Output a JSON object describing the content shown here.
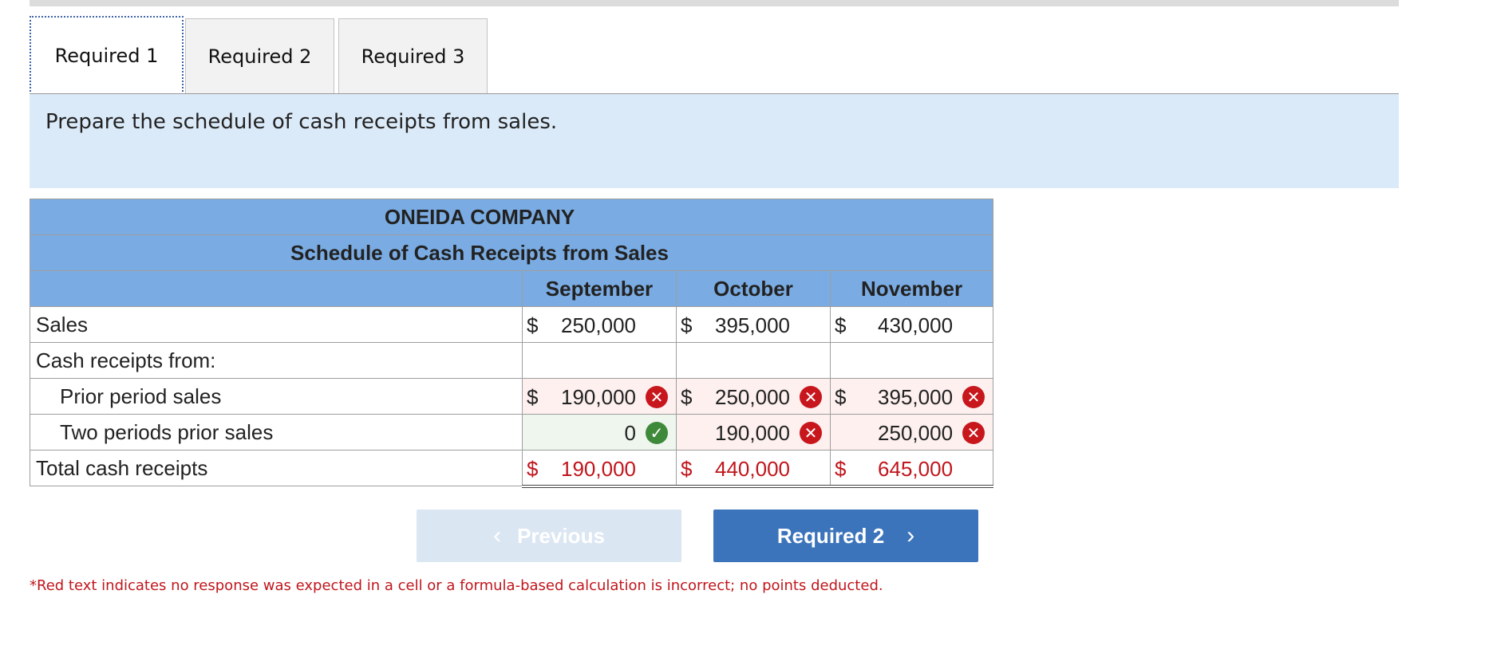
{
  "tabs": [
    {
      "label": "Required 1",
      "active": true
    },
    {
      "label": "Required 2",
      "active": false
    },
    {
      "label": "Required 3",
      "active": false
    }
  ],
  "instruction": "Prepare the schedule of cash receipts from sales.",
  "schedule": {
    "company": "ONEIDA COMPANY",
    "title": "Schedule of Cash Receipts from Sales",
    "columns": [
      "September",
      "October",
      "November"
    ],
    "currency_symbol": "$",
    "rows": {
      "sales": {
        "label": "Sales",
        "values": [
          "250,000",
          "395,000",
          "430,000"
        ]
      },
      "cash_receipts_from": {
        "label": "Cash receipts from:"
      },
      "prior_period": {
        "label": "Prior period sales",
        "values": [
          "190,000",
          "250,000",
          "395,000"
        ],
        "status": [
          "incorrect",
          "incorrect",
          "incorrect"
        ]
      },
      "two_periods_prior": {
        "label": "Two periods prior sales",
        "values": [
          "0",
          "190,000",
          "250,000"
        ],
        "status": [
          "correct",
          "incorrect",
          "incorrect"
        ]
      },
      "total": {
        "label": "Total cash receipts",
        "values": [
          "190,000",
          "440,000",
          "645,000"
        ]
      }
    }
  },
  "buttons": {
    "previous": "Previous",
    "next": "Required 2"
  },
  "footnote": "*Red text indicates no response was expected in a cell or a formula-based calculation is incorrect; no points deducted.",
  "colors": {
    "header_blue": "#7aace3",
    "instruction_bg": "#dbeaf8",
    "error_red": "#c8161d",
    "correct_green": "#3f8a3a",
    "button_blue": "#3c74bc"
  }
}
